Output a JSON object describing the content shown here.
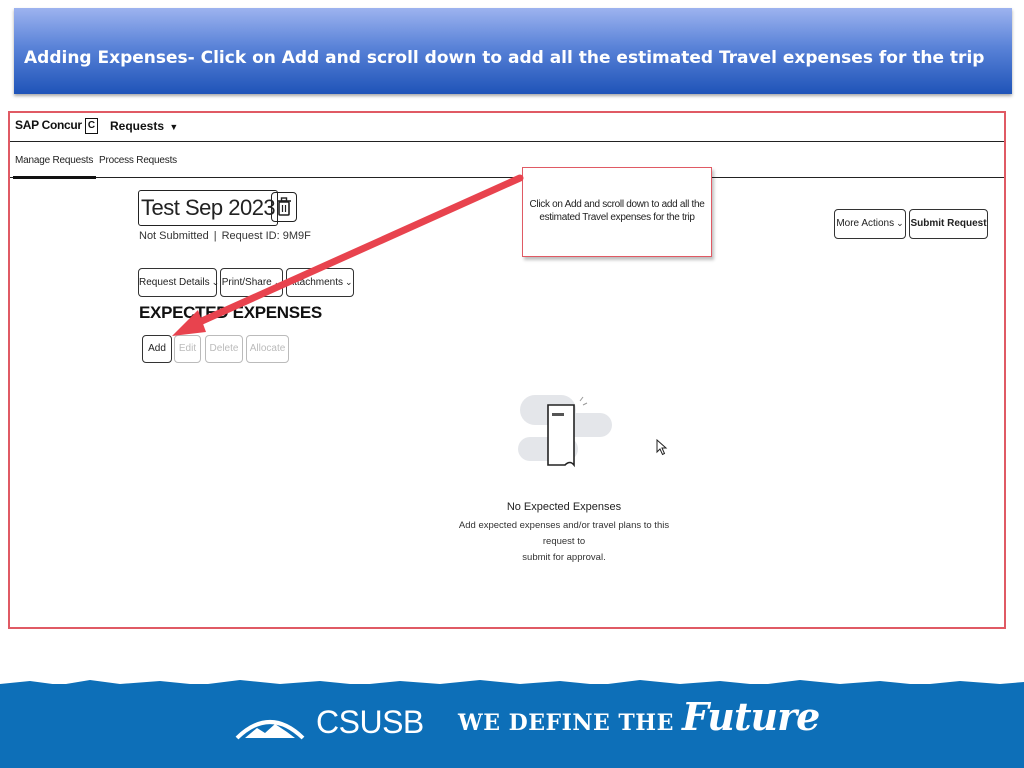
{
  "slide": {
    "title": "Adding Expenses- Click on Add and scroll down to add all the estimated Travel expenses for the trip"
  },
  "app": {
    "logo_text": "SAP Concur",
    "logo_mark": "C",
    "nav_menu": "Requests",
    "tabs": [
      "Manage Requests",
      "Process Requests"
    ]
  },
  "request": {
    "name": "Test Sep 2023",
    "status": "Not Submitted",
    "request_id": "Request ID: 9M9F"
  },
  "dropdowns": {
    "details": "Request Details",
    "print": "Print/Share",
    "attachments": "Attachments"
  },
  "right_actions": {
    "more": "More Actions",
    "submit": "Submit Request"
  },
  "section": {
    "title": "EXPECTED EXPENSES"
  },
  "actions": {
    "add": "Add",
    "edit": "Edit",
    "delete": "Delete",
    "allocate": "Allocate"
  },
  "empty_state": {
    "title": "No Expected Expenses",
    "line1": "Add expected expenses and/or travel plans to this request to",
    "line2": "submit for approval."
  },
  "callout": {
    "line1": "Click on Add and scroll down to add all the",
    "line2": "estimated Travel expenses for the trip"
  },
  "footer": {
    "brand": "CSUSB",
    "tagline": "WE DEFINE THE",
    "tagline_script": "Future",
    "band_color": "#0d6fb8"
  },
  "colors": {
    "accent_red": "#e05a64",
    "header_blue": "#1f54b8"
  }
}
